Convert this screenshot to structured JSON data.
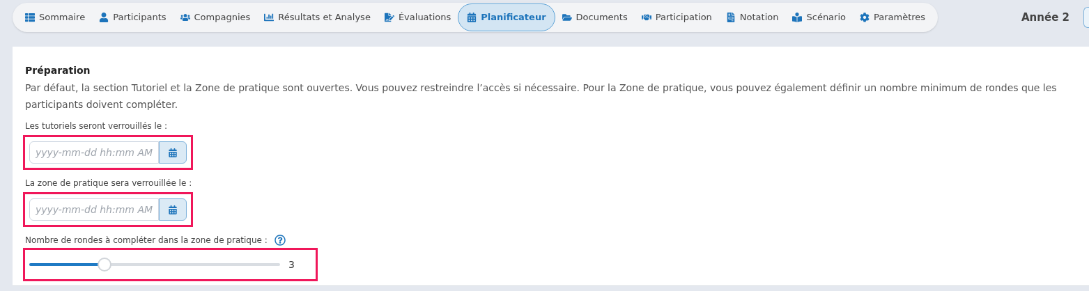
{
  "nav": {
    "tabs": [
      {
        "label": "Sommaire",
        "selected": false
      },
      {
        "label": "Participants",
        "selected": false
      },
      {
        "label": "Compagnies",
        "selected": false
      },
      {
        "label": "Résultats et Analyse",
        "selected": false
      },
      {
        "label": "Évaluations",
        "selected": false
      },
      {
        "label": "Planificateur",
        "selected": true
      },
      {
        "label": "Documents",
        "selected": false
      },
      {
        "label": "Participation",
        "selected": false
      },
      {
        "label": "Notation",
        "selected": false
      },
      {
        "label": "Scénario",
        "selected": false
      },
      {
        "label": "Paramètres",
        "selected": false
      }
    ],
    "year": "Année 2"
  },
  "section": {
    "title": "Préparation",
    "description": "Par défaut, la section Tutoriel et la Zone de pratique sont ouvertes. Vous pouvez restreindre l’accès si nécessaire. Pour la Zone de pratique, vous pouvez également définir un nombre minimum de rondes que les participants doivent compléter.",
    "fields": [
      {
        "kind": "date",
        "label": "Les tutoriels seront verrouillés le :",
        "placeholder": "yyyy-mm-dd hh:mm AM"
      },
      {
        "kind": "date",
        "label": "La zone de pratique sera verrouillée le :",
        "placeholder": "yyyy-mm-dd hh:mm AM"
      },
      {
        "kind": "slider",
        "label": "Nombre de rondes à compléter dans la zone de pratique :",
        "level": 0.3,
        "reading": "3"
      }
    ]
  }
}
